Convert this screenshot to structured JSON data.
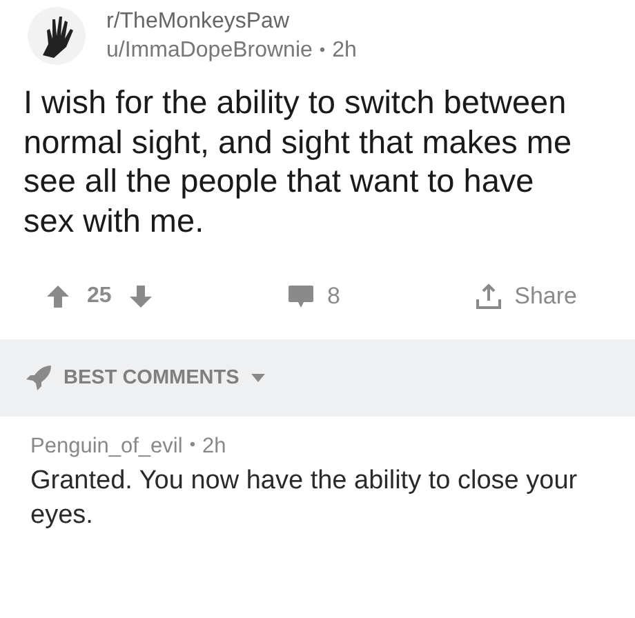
{
  "post": {
    "subreddit": "r/TheMonkeysPaw",
    "author": "u/ImmaDopeBrownie",
    "separator": "•",
    "time": "2h",
    "title": "I wish for the ability to switch between normal sight, and sight that makes me see all the people that want to have sex with me.",
    "score": "25",
    "comments": "8",
    "share": "Share"
  },
  "sort": {
    "label": "BEST COMMENTS"
  },
  "comments": [
    {
      "author": "Penguin_of_evil",
      "separator": "•",
      "time": "2h",
      "body": "Granted. You now have the ability to close your eyes."
    }
  ]
}
